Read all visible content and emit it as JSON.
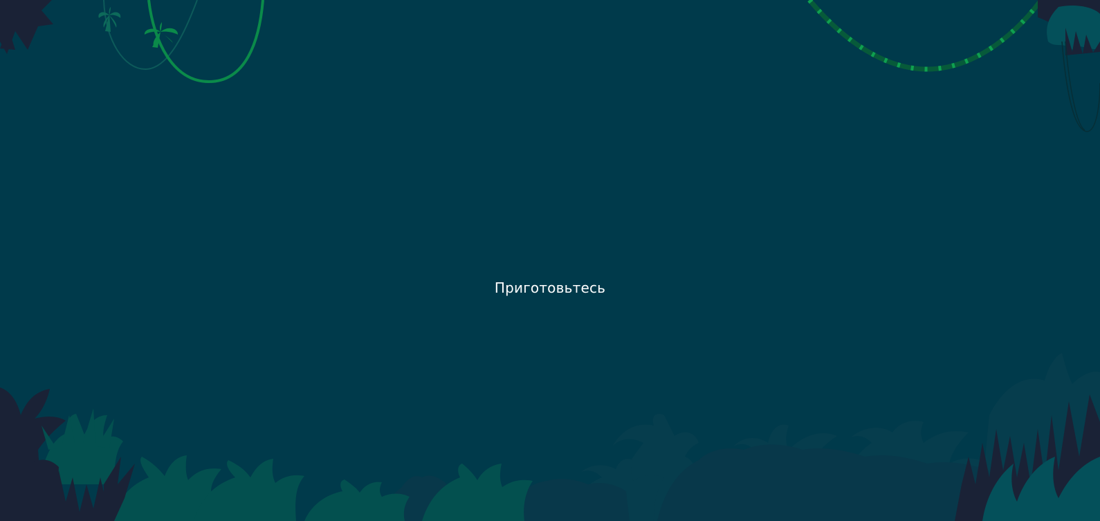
{
  "screen": {
    "status_text": "Приготовьтесь"
  },
  "scene": {
    "background_color": "#003a4b",
    "vine_green": "#0b8a4a",
    "vine_dark": "#075a3a",
    "vine_faint": "#0d5a5a",
    "foliage_dark": "#1a2236",
    "foliage_teal": "#03504f",
    "foliage_mid": "#063d4d",
    "foliage_shadow": "#08384a",
    "icons": [
      "palm-tree-icon",
      "palm-tree-icon",
      "vine-decoration",
      "bush-decoration",
      "leaf-decoration"
    ]
  }
}
